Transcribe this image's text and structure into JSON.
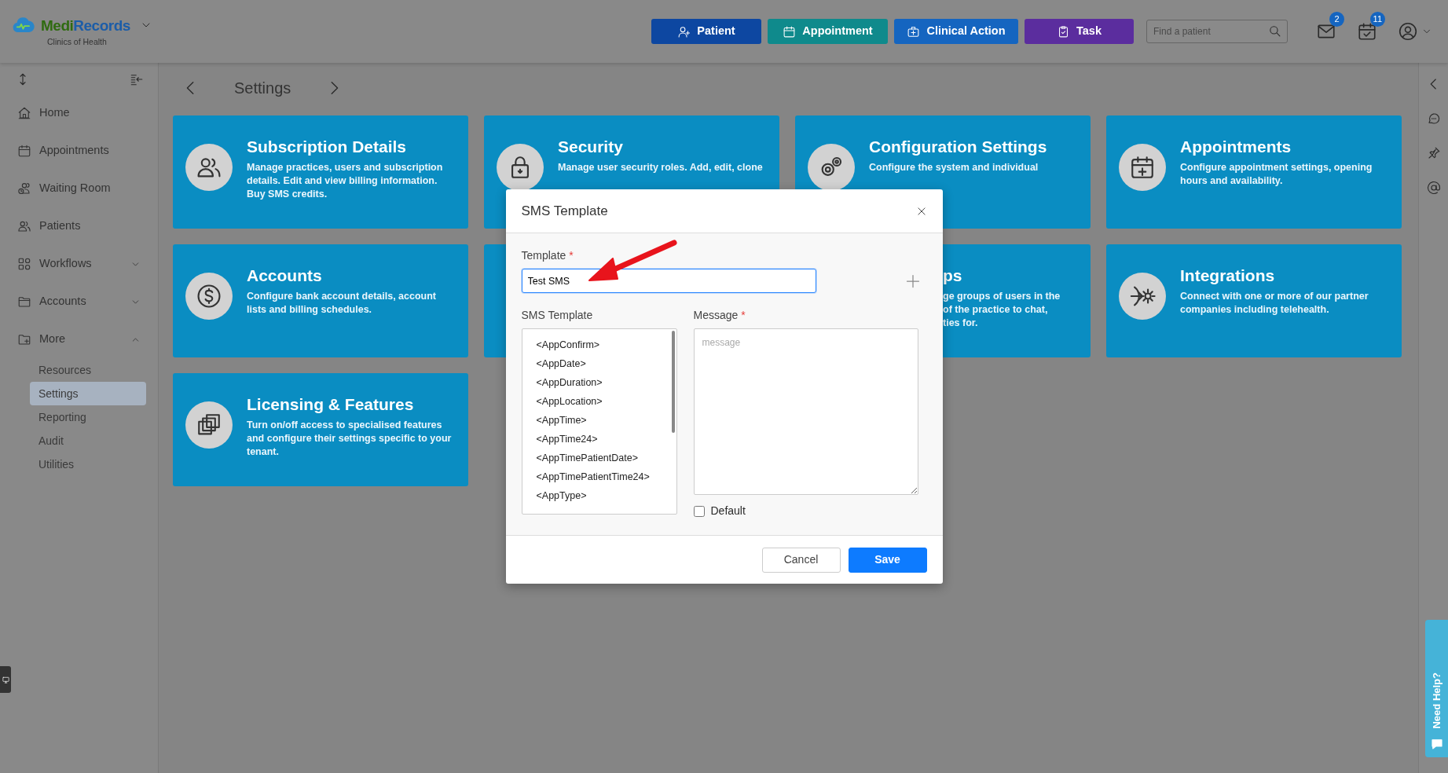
{
  "header": {
    "brand_prefix": "Medi",
    "brand_suffix": "Records",
    "subtitle": "Clinics of Health",
    "actions": [
      {
        "label": "Patient",
        "color": "#0d47a1"
      },
      {
        "label": "Appointment",
        "color": "#0f8a8c"
      },
      {
        "label": "Clinical Action",
        "color": "#1565c0"
      },
      {
        "label": "Task",
        "color": "#5b2d9e"
      }
    ],
    "search": {
      "placeholder": "Find a patient"
    },
    "notifications": [
      {
        "count": "2"
      },
      {
        "count": "11"
      }
    ]
  },
  "sidebar": {
    "items": [
      {
        "label": "Home"
      },
      {
        "label": "Appointments"
      },
      {
        "label": "Waiting Room"
      },
      {
        "label": "Patients"
      },
      {
        "label": "Workflows",
        "expanded": false
      },
      {
        "label": "Accounts",
        "expanded": false
      },
      {
        "label": "More",
        "expanded": true,
        "children": [
          {
            "label": "Resources",
            "selected": false
          },
          {
            "label": "Settings",
            "selected": true
          },
          {
            "label": "Reporting",
            "selected": false
          },
          {
            "label": "Audit",
            "selected": false
          },
          {
            "label": "Utilities",
            "selected": false
          }
        ]
      }
    ]
  },
  "page": {
    "title": "Settings"
  },
  "cards": [
    {
      "kind": "full",
      "title": "Subscription Details",
      "description": "Manage practices, users and subscription details. Edit and view billing information. Buy SMS credits."
    },
    {
      "kind": "full",
      "title": "Security",
      "description": "Manage user security roles. Add, edit, clone"
    },
    {
      "kind": "full",
      "title": "Configuration Settings",
      "description": "Configure the system and individual"
    },
    {
      "kind": "full",
      "title": "Appointments",
      "description": "Configure appointment settings, opening hours and availability."
    },
    {
      "kind": "full",
      "title": "Accounts",
      "description": "Configure bank account details, account lists and billing schedules."
    },
    {
      "kind": "covered"
    },
    {
      "kind": "clipped",
      "title": "ps",
      "lines": [
        "ge groups of users in the",
        "of the practice to chat,",
        "ties for."
      ]
    },
    {
      "kind": "full",
      "title": "Integrations",
      "description": "Connect with one or more of our partner companies including telehealth."
    },
    {
      "kind": "full",
      "title": "Licensing & Features",
      "description": "Turn on/off access to specialised features and configure their settings specific to your tenant."
    }
  ],
  "modal": {
    "title": "SMS Template",
    "template_field": {
      "label": "Template",
      "required_mark": "*",
      "value": "Test SMS"
    },
    "list": {
      "label": "SMS Template",
      "items": [
        "<AppConfirm>",
        "<AppDate>",
        "<AppDuration>",
        "<AppLocation>",
        "<AppTime>",
        "<AppTime24>",
        "<AppTimePatientDate>",
        "<AppTimePatientTime24>",
        "<AppType>"
      ]
    },
    "message": {
      "label": "Message",
      "required_mark": "*",
      "placeholder": "message"
    },
    "default_checkbox": {
      "label": "Default",
      "checked": false
    },
    "buttons": [
      {
        "label": "Cancel",
        "kind": "secondary"
      },
      {
        "label": "Save",
        "kind": "primary"
      }
    ]
  },
  "help_tab": {
    "label": "Need Help?"
  }
}
